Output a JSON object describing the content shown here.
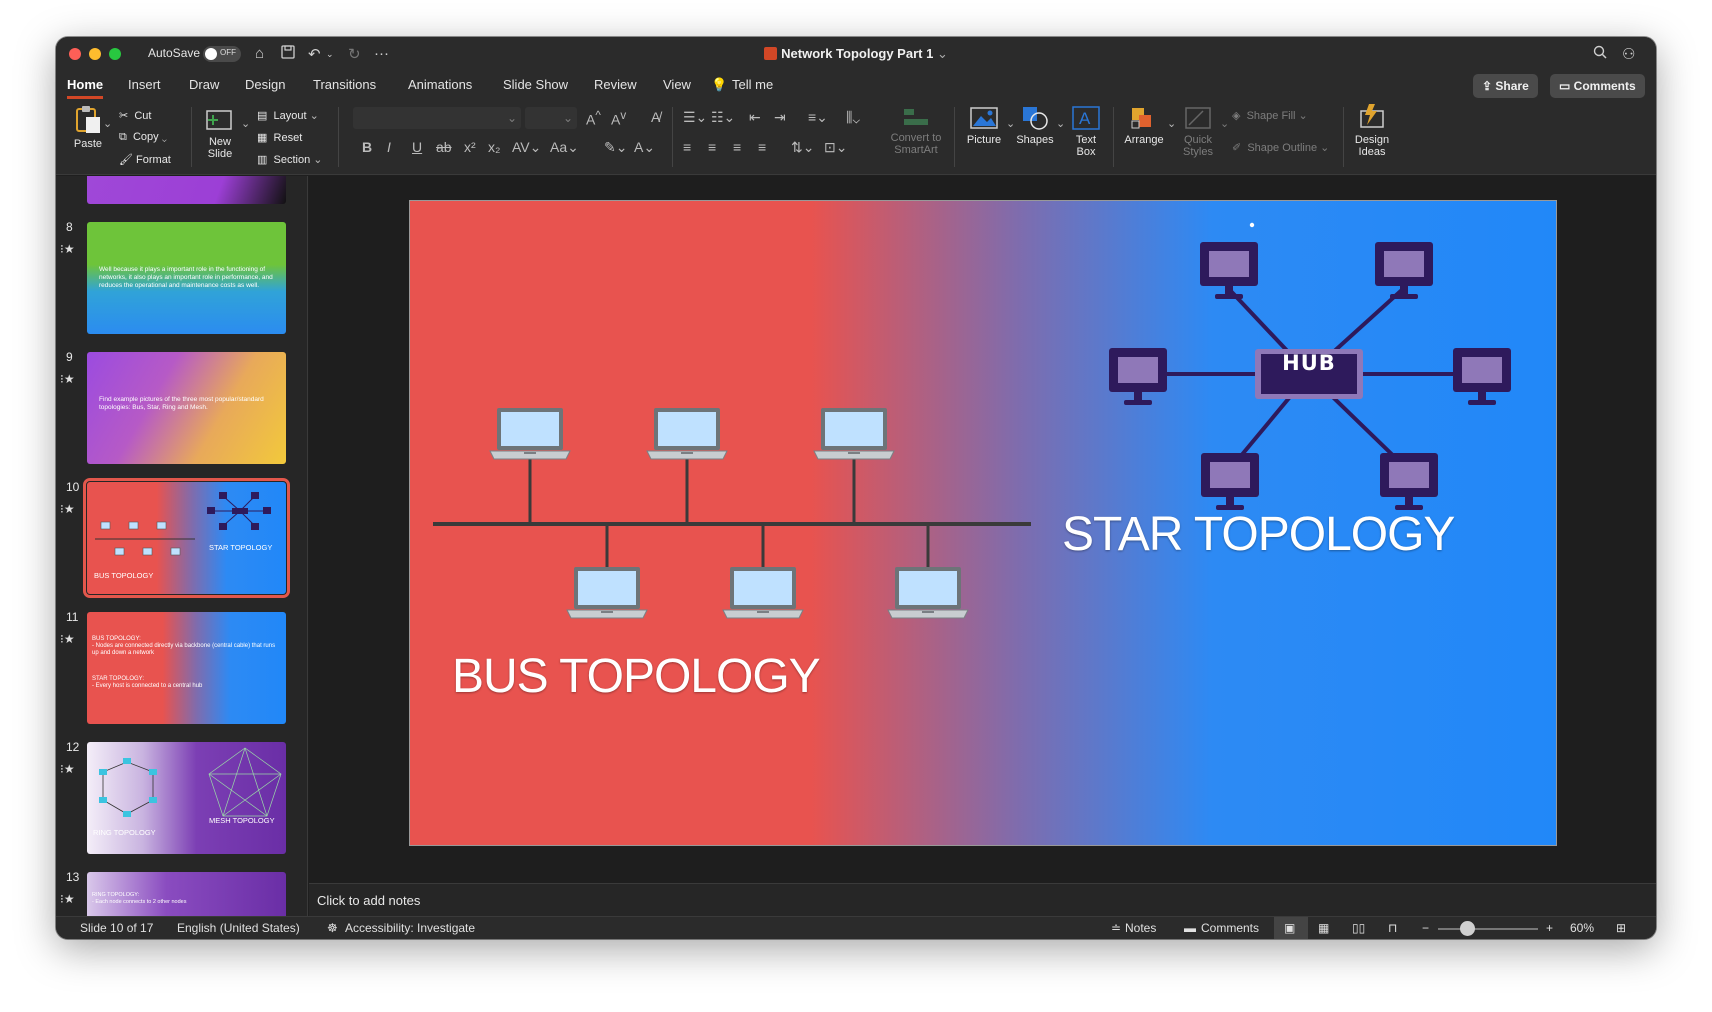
{
  "window": {
    "autosave_label": "AutoSave",
    "autosave_state": "OFF",
    "doc_title": "Network Topology Part 1"
  },
  "menu": {
    "tabs": [
      "Home",
      "Insert",
      "Draw",
      "Design",
      "Transitions",
      "Animations",
      "Slide Show",
      "Review",
      "View"
    ],
    "tell_me": "Tell me",
    "share": "Share",
    "comments": "Comments"
  },
  "ribbon": {
    "paste": "Paste",
    "cut": "Cut",
    "copy": "Copy",
    "format": "Format",
    "new_slide_1": "New",
    "new_slide_2": "Slide",
    "layout": "Layout",
    "reset": "Reset",
    "section": "Section",
    "convert_1": "Convert to",
    "convert_2": "SmartArt",
    "picture": "Picture",
    "shapes": "Shapes",
    "textbox_1": "Text",
    "textbox_2": "Box",
    "arrange": "Arrange",
    "quick_1": "Quick",
    "quick_2": "Styles",
    "shape_fill": "Shape Fill",
    "shape_outline": "Shape Outline",
    "design_1": "Design",
    "design_2": "Ideas"
  },
  "thumbnails": [
    {
      "num": "8",
      "text": "Well because it plays a important role in the functioning of networks, it also plays an important role in performance, and reduces the operational and maintenance costs as well."
    },
    {
      "num": "9",
      "text": "Find example pictures of the three most popular/standard topologies: Bus, Star, Ring and Mesh."
    },
    {
      "num": "10",
      "bus": "BUS TOPOLOGY",
      "star": "STAR TOPOLOGY"
    },
    {
      "num": "11",
      "line1": "BUS TOPOLOGY:",
      "line2": "- Nodes are connected directly via backbone (central cable) that runs up and down a network",
      "line3": "STAR TOPOLOGY:",
      "line4": "- Every host is connected to a central hub"
    },
    {
      "num": "12",
      "ring": "RING TOPOLOGY",
      "mesh": "MESH TOPOLOGY"
    },
    {
      "num": "13",
      "line1": "RING TOPOLOGY:",
      "line2": "- Each node connects to 2 other nodes"
    }
  ],
  "slide": {
    "bus_title": "BUS TOPOLOGY",
    "star_title": "STAR TOPOLOGY",
    "hub_label": "HUB"
  },
  "notes_placeholder": "Click to add notes",
  "status": {
    "slide_pos": "Slide 10 of 17",
    "language": "English (United States)",
    "accessibility": "Accessibility: Investigate",
    "notes": "Notes",
    "comments": "Comments",
    "zoom": "60%"
  },
  "colors": {
    "accent": "#d24726",
    "slide_red": "#e8534f",
    "slide_blue": "#2188f8",
    "star_node": "#2e1a5c",
    "star_screen": "#8f78b8"
  }
}
